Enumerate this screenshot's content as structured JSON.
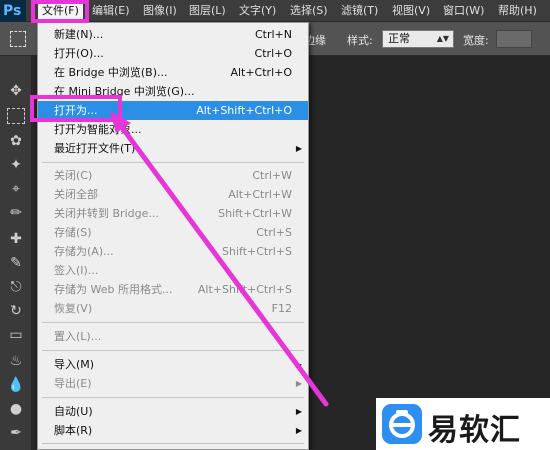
{
  "app": {
    "logo": "Ps"
  },
  "menubar": {
    "items": [
      "文件(F)",
      "编辑(E)",
      "图像(I)",
      "图层(L)",
      "文字(Y)",
      "选择(S)",
      "滤镜(T)",
      "视图(V)",
      "窗口(W)",
      "帮助(H)"
    ]
  },
  "options": {
    "partial_label": "调整边缘",
    "style_label": "样式:",
    "style_value": "正常",
    "width_label": "宽度:"
  },
  "file_menu": {
    "items": [
      {
        "label": "新建(N)...",
        "shortcut": "Ctrl+N"
      },
      {
        "label": "打开(O)...",
        "shortcut": "Ctrl+O"
      },
      {
        "label": "在 Bridge 中浏览(B)...",
        "shortcut": "Alt+Ctrl+O"
      },
      {
        "label": "在 Mini Bridge 中浏览(G)...",
        "shortcut": ""
      },
      {
        "label": "打开为...",
        "shortcut": "Alt+Shift+Ctrl+O"
      },
      {
        "label": "打开为智能对象...",
        "shortcut": ""
      },
      {
        "label": "最近打开文件(T)",
        "shortcut": ""
      },
      {
        "label": "关闭(C)",
        "shortcut": "Ctrl+W"
      },
      {
        "label": "关闭全部",
        "shortcut": "Alt+Ctrl+W"
      },
      {
        "label": "关闭并转到 Bridge...",
        "shortcut": "Shift+Ctrl+W"
      },
      {
        "label": "存储(S)",
        "shortcut": "Ctrl+S"
      },
      {
        "label": "存储为(A)...",
        "shortcut": "Shift+Ctrl+S"
      },
      {
        "label": "签入(I)...",
        "shortcut": ""
      },
      {
        "label": "存储为 Web 所用格式...",
        "shortcut": "Alt+Shift+Ctrl+S"
      },
      {
        "label": "恢复(V)",
        "shortcut": "F12"
      },
      {
        "label": "置入(L)...",
        "shortcut": ""
      },
      {
        "label": "导入(M)",
        "shortcut": ""
      },
      {
        "label": "导出(E)",
        "shortcut": ""
      },
      {
        "label": "自动(U)",
        "shortcut": ""
      },
      {
        "label": "脚本(R)",
        "shortcut": ""
      }
    ]
  },
  "watermark": {
    "text": "易软汇"
  },
  "colors": {
    "highlight": "#2c8fe6",
    "annotation": "#e536d8",
    "menu_bg": "#efefef"
  }
}
